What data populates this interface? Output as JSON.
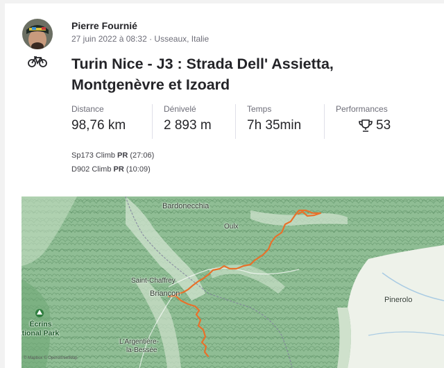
{
  "athlete": {
    "name": "Pierre Fournié",
    "meta": "27 juin 2022 à 08:32 · Usseaux, Italie"
  },
  "activity": {
    "sport_icon": "bike-icon",
    "title_line1": "Turin Nice - J3 : Strada Dell' Assietta,",
    "title_line2": "Montgenèvre et Izoard"
  },
  "stats": [
    {
      "label": "Distance",
      "value": "98,76 km"
    },
    {
      "label": "Dénivelé",
      "value": "2 893 m"
    },
    {
      "label": "Temps",
      "value": "7h 35min"
    },
    {
      "label": "Performances",
      "value": "53",
      "icon": "trophy-icon"
    }
  ],
  "segments": [
    {
      "name": "Sp173 Climb",
      "badge": "PR",
      "time": "(27:06)"
    },
    {
      "name": "D902 Climb",
      "badge": "PR",
      "time": "(10:09)"
    }
  ],
  "map": {
    "places": [
      "Bardonecchia",
      "Oulx",
      "Saint-Chaffrey",
      "Briançon",
      "Pinerolo",
      "L'Argentière-",
      "la-Bessée"
    ],
    "park_line1": "Écrins",
    "park_line2": "ational Park",
    "attribution": "© Mapbox © OpenStreetMap",
    "route_color": "#e8712a",
    "terrain_color": "#7fae86"
  }
}
